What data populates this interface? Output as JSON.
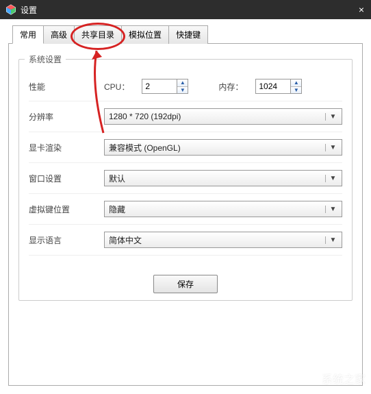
{
  "window": {
    "title": "设置",
    "close": "×"
  },
  "tabs": {
    "t0": "常用",
    "t1": "高级",
    "t2": "共享目录",
    "t3": "模拟位置",
    "t4": "快捷键"
  },
  "group": {
    "title": "系统设置"
  },
  "rows": {
    "perf": {
      "label": "性能",
      "cpu_label": "CPU：",
      "cpu_value": "2",
      "mem_label": "内存：",
      "mem_value": "1024"
    },
    "res": {
      "label": "分辨率",
      "value": "1280 * 720 (192dpi)"
    },
    "gpu": {
      "label": "显卡渲染",
      "value": "兼容模式 (OpenGL)"
    },
    "win": {
      "label": "窗口设置",
      "value": "默认"
    },
    "vkb": {
      "label": "虚拟键位置",
      "value": "隐藏"
    },
    "lang": {
      "label": "显示语言",
      "value": "简体中文"
    }
  },
  "save": {
    "label": "保存"
  },
  "watermark": {
    "text": "系统之家"
  }
}
